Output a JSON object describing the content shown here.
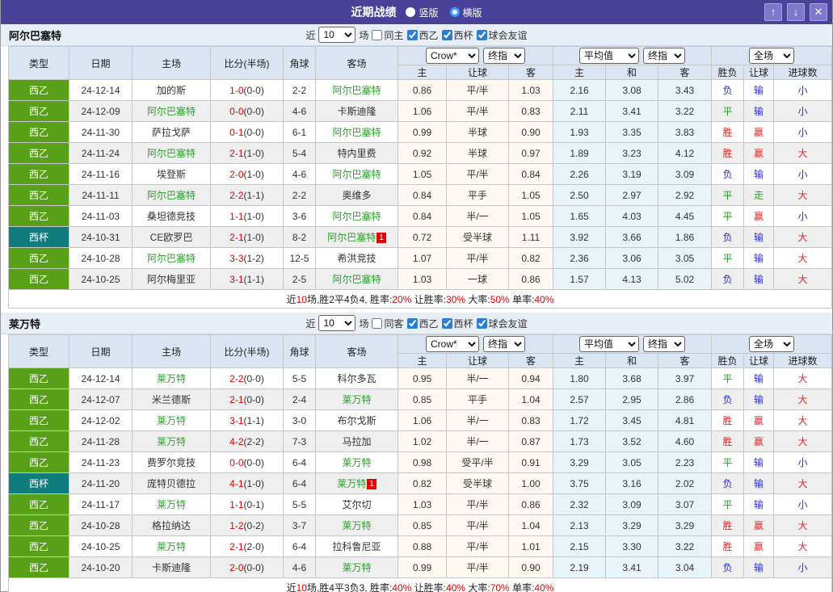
{
  "colors": {
    "titlebar": "#4a4198",
    "titlebar_button": "#7f77cb",
    "titlebar_button_border": "#aaa3e0",
    "filter_bg": "#e8eef5",
    "thead_bg": "#dbe5f1",
    "row_alt": "#efefef",
    "border": "#c6c6c6",
    "league_green": "#58a018",
    "cup_teal": "#0e7d7c",
    "team_green": "#2d9f2d",
    "score_red": "#e60000",
    "odds_bg": "#fdf8f1",
    "avg_bg": "#e9f4f8",
    "res_red": "#e02b2b",
    "res_blue": "#2c2cd8",
    "res_green": "#2d9f2d",
    "summary_red": "#e60000"
  },
  "titlebar": {
    "title": "近期战绩",
    "radios": [
      {
        "label": "竖版",
        "selected": false
      },
      {
        "label": "横版",
        "selected": true
      }
    ],
    "buttons": {
      "up": "↑",
      "down": "↓",
      "close": "✕"
    }
  },
  "filter_labels": {
    "near": "近",
    "games": "场"
  },
  "columns": {
    "static": [
      "类型",
      "日期",
      "主场",
      "比分(半场)",
      "角球",
      "客场"
    ],
    "sub": [
      "主",
      "让球",
      "客",
      "主",
      "和",
      "客",
      "胜负",
      "让球",
      "进球数"
    ]
  },
  "table_controls": {
    "book": "Crow*",
    "final1": "终指",
    "avg": "平均值",
    "final2": "终指",
    "full": "全场"
  },
  "sections": [
    {
      "team": "阿尔巴塞特",
      "filter": {
        "count": "10",
        "same": {
          "label": "同主",
          "checked": false
        },
        "cups": [
          {
            "label": "西乙",
            "checked": true
          },
          {
            "label": "西杯",
            "checked": true
          },
          {
            "label": "球会友谊",
            "checked": true
          }
        ]
      },
      "rows": [
        {
          "c": "league",
          "type": "西乙",
          "date": "24-12-14",
          "home": "加的斯",
          "hh": false,
          "score": "1-0",
          "half": "(0-0)",
          "corner": "2-2",
          "away": "阿尔巴塞特",
          "ah": true,
          "badge": "",
          "odds": [
            "0.86",
            "平/半",
            "1.03"
          ],
          "avg": [
            "2.16",
            "3.08",
            "3.43"
          ],
          "res": [
            [
              "负",
              "b"
            ],
            [
              "输",
              "b"
            ],
            [
              "小",
              "b"
            ]
          ]
        },
        {
          "c": "league",
          "type": "西乙",
          "date": "24-12-09",
          "home": "阿尔巴塞特",
          "hh": true,
          "score": "0-0",
          "half": "(0-0)",
          "corner": "4-6",
          "away": "卡斯迪隆",
          "ah": false,
          "badge": "",
          "odds": [
            "1.06",
            "平/半",
            "0.83"
          ],
          "avg": [
            "2.11",
            "3.41",
            "3.22"
          ],
          "res": [
            [
              "平",
              "g"
            ],
            [
              "输",
              "b"
            ],
            [
              "小",
              "b"
            ]
          ]
        },
        {
          "c": "league",
          "type": "西乙",
          "date": "24-11-30",
          "home": "萨拉戈萨",
          "hh": false,
          "score": "0-1",
          "half": "(0-0)",
          "corner": "6-1",
          "away": "阿尔巴塞特",
          "ah": true,
          "badge": "",
          "odds": [
            "0.99",
            "半球",
            "0.90"
          ],
          "avg": [
            "1.93",
            "3.35",
            "3.83"
          ],
          "res": [
            [
              "胜",
              "r"
            ],
            [
              "赢",
              "r"
            ],
            [
              "小",
              "b"
            ]
          ]
        },
        {
          "c": "league",
          "type": "西乙",
          "date": "24-11-24",
          "home": "阿尔巴塞特",
          "hh": true,
          "score": "2-1",
          "half": "(1-0)",
          "corner": "5-4",
          "away": "特内里费",
          "ah": false,
          "badge": "",
          "odds": [
            "0.92",
            "半球",
            "0.97"
          ],
          "avg": [
            "1.89",
            "3.23",
            "4.12"
          ],
          "res": [
            [
              "胜",
              "r"
            ],
            [
              "赢",
              "r"
            ],
            [
              "大",
              "r"
            ]
          ]
        },
        {
          "c": "league",
          "type": "西乙",
          "date": "24-11-16",
          "home": "埃登斯",
          "hh": false,
          "score": "2-0",
          "half": "(1-0)",
          "corner": "4-6",
          "away": "阿尔巴塞特",
          "ah": true,
          "badge": "",
          "odds": [
            "1.05",
            "平/半",
            "0.84"
          ],
          "avg": [
            "2.26",
            "3.19",
            "3.09"
          ],
          "res": [
            [
              "负",
              "b"
            ],
            [
              "输",
              "b"
            ],
            [
              "小",
              "b"
            ]
          ]
        },
        {
          "c": "league",
          "type": "西乙",
          "date": "24-11-11",
          "home": "阿尔巴塞特",
          "hh": true,
          "score": "2-2",
          "half": "(1-1)",
          "corner": "2-2",
          "away": "奥维多",
          "ah": false,
          "badge": "",
          "odds": [
            "0.84",
            "平手",
            "1.05"
          ],
          "avg": [
            "2.50",
            "2.97",
            "2.92"
          ],
          "res": [
            [
              "平",
              "g"
            ],
            [
              "走",
              "g"
            ],
            [
              "大",
              "r"
            ]
          ]
        },
        {
          "c": "league",
          "type": "西乙",
          "date": "24-11-03",
          "home": "桑坦德竞技",
          "hh": false,
          "score": "1-1",
          "half": "(1-0)",
          "corner": "3-6",
          "away": "阿尔巴塞特",
          "ah": true,
          "badge": "",
          "odds": [
            "0.84",
            "半/一",
            "1.05"
          ],
          "avg": [
            "1.65",
            "4.03",
            "4.45"
          ],
          "res": [
            [
              "平",
              "g"
            ],
            [
              "赢",
              "r"
            ],
            [
              "小",
              "b"
            ]
          ]
        },
        {
          "c": "cup",
          "type": "西杯",
          "date": "24-10-31",
          "home": "CE欧罗巴",
          "hh": false,
          "score": "2-1",
          "half": "(1-0)",
          "corner": "8-2",
          "away": "阿尔巴塞特",
          "ah": true,
          "badge": "1",
          "odds": [
            "0.72",
            "受半球",
            "1.11"
          ],
          "avg": [
            "3.92",
            "3.66",
            "1.86"
          ],
          "res": [
            [
              "负",
              "b"
            ],
            [
              "输",
              "b"
            ],
            [
              "大",
              "r"
            ]
          ]
        },
        {
          "c": "league",
          "type": "西乙",
          "date": "24-10-28",
          "home": "阿尔巴塞特",
          "hh": true,
          "score": "3-3",
          "half": "(1-2)",
          "corner": "12-5",
          "away": "希洪竞技",
          "ah": false,
          "badge": "",
          "odds": [
            "1.07",
            "平/半",
            "0.82"
          ],
          "avg": [
            "2.36",
            "3.06",
            "3.05"
          ],
          "res": [
            [
              "平",
              "g"
            ],
            [
              "输",
              "b"
            ],
            [
              "大",
              "r"
            ]
          ]
        },
        {
          "c": "league",
          "type": "西乙",
          "date": "24-10-25",
          "home": "阿尔梅里亚",
          "hh": false,
          "score": "3-1",
          "half": "(1-1)",
          "corner": "2-5",
          "away": "阿尔巴塞特",
          "ah": true,
          "badge": "",
          "odds": [
            "1.03",
            "一球",
            "0.86"
          ],
          "avg": [
            "1.57",
            "4.13",
            "5.02"
          ],
          "res": [
            [
              "负",
              "b"
            ],
            [
              "输",
              "b"
            ],
            [
              "大",
              "r"
            ]
          ]
        }
      ],
      "summary": [
        {
          "t": "近",
          "red": false
        },
        {
          "t": "10",
          "red": true
        },
        {
          "t": "场,胜2平4负4, 胜率:",
          "red": false
        },
        {
          "t": "20%",
          "red": true
        },
        {
          "t": " 让胜率:",
          "red": false
        },
        {
          "t": "30%",
          "red": true
        },
        {
          "t": " 大率:",
          "red": false
        },
        {
          "t": "50%",
          "red": true
        },
        {
          "t": " 单率:",
          "red": false
        },
        {
          "t": "40%",
          "red": true
        }
      ]
    },
    {
      "team": "莱万特",
      "filter": {
        "count": "10",
        "same": {
          "label": "同客",
          "checked": false
        },
        "cups": [
          {
            "label": "西乙",
            "checked": true
          },
          {
            "label": "西杯",
            "checked": true
          },
          {
            "label": "球会友谊",
            "checked": true
          }
        ]
      },
      "rows": [
        {
          "c": "league",
          "type": "西乙",
          "date": "24-12-14",
          "home": "莱万特",
          "hh": true,
          "score": "2-2",
          "half": "(0-0)",
          "corner": "5-5",
          "away": "科尔多瓦",
          "ah": false,
          "badge": "",
          "odds": [
            "0.95",
            "半/一",
            "0.94"
          ],
          "avg": [
            "1.80",
            "3.68",
            "3.97"
          ],
          "res": [
            [
              "平",
              "g"
            ],
            [
              "输",
              "b"
            ],
            [
              "大",
              "r"
            ]
          ]
        },
        {
          "c": "league",
          "type": "西乙",
          "date": "24-12-07",
          "home": "米兰德斯",
          "hh": false,
          "score": "2-1",
          "half": "(0-0)",
          "corner": "2-4",
          "away": "莱万特",
          "ah": true,
          "badge": "",
          "odds": [
            "0.85",
            "平手",
            "1.04"
          ],
          "avg": [
            "2.57",
            "2.95",
            "2.86"
          ],
          "res": [
            [
              "负",
              "b"
            ],
            [
              "输",
              "b"
            ],
            [
              "大",
              "r"
            ]
          ]
        },
        {
          "c": "league",
          "type": "西乙",
          "date": "24-12-02",
          "home": "莱万特",
          "hh": true,
          "score": "3-1",
          "half": "(1-1)",
          "corner": "3-0",
          "away": "布尔戈斯",
          "ah": false,
          "badge": "",
          "odds": [
            "1.06",
            "半/一",
            "0.83"
          ],
          "avg": [
            "1.72",
            "3.45",
            "4.81"
          ],
          "res": [
            [
              "胜",
              "r"
            ],
            [
              "赢",
              "r"
            ],
            [
              "大",
              "r"
            ]
          ]
        },
        {
          "c": "league",
          "type": "西乙",
          "date": "24-11-28",
          "home": "莱万特",
          "hh": true,
          "score": "4-2",
          "half": "(2-2)",
          "corner": "7-3",
          "away": "马拉加",
          "ah": false,
          "badge": "",
          "odds": [
            "1.02",
            "半/一",
            "0.87"
          ],
          "avg": [
            "1.73",
            "3.52",
            "4.60"
          ],
          "res": [
            [
              "胜",
              "r"
            ],
            [
              "赢",
              "r"
            ],
            [
              "大",
              "r"
            ]
          ]
        },
        {
          "c": "league",
          "type": "西乙",
          "date": "24-11-23",
          "home": "费罗尔竞技",
          "hh": false,
          "score": "0-0",
          "half": "(0-0)",
          "corner": "6-4",
          "away": "莱万特",
          "ah": true,
          "badge": "",
          "odds": [
            "0.98",
            "受平/半",
            "0.91"
          ],
          "avg": [
            "3.29",
            "3.05",
            "2.23"
          ],
          "res": [
            [
              "平",
              "g"
            ],
            [
              "输",
              "b"
            ],
            [
              "小",
              "b"
            ]
          ]
        },
        {
          "c": "cup",
          "type": "西杯",
          "date": "24-11-20",
          "home": "庞特贝德拉",
          "hh": false,
          "score": "4-1",
          "half": "(1-0)",
          "corner": "6-4",
          "away": "莱万特",
          "ah": true,
          "badge": "1",
          "odds": [
            "0.82",
            "受半球",
            "1.00"
          ],
          "avg": [
            "3.75",
            "3.16",
            "2.02"
          ],
          "res": [
            [
              "负",
              "b"
            ],
            [
              "输",
              "b"
            ],
            [
              "大",
              "r"
            ]
          ]
        },
        {
          "c": "league",
          "type": "西乙",
          "date": "24-11-17",
          "home": "莱万特",
          "hh": true,
          "score": "1-1",
          "half": "(0-1)",
          "corner": "5-5",
          "away": "艾尔切",
          "ah": false,
          "badge": "",
          "odds": [
            "1.03",
            "平/半",
            "0.86"
          ],
          "avg": [
            "2.32",
            "3.09",
            "3.07"
          ],
          "res": [
            [
              "平",
              "g"
            ],
            [
              "输",
              "b"
            ],
            [
              "小",
              "b"
            ]
          ]
        },
        {
          "c": "league",
          "type": "西乙",
          "date": "24-10-28",
          "home": "格拉纳达",
          "hh": false,
          "score": "1-2",
          "half": "(0-2)",
          "corner": "3-7",
          "away": "莱万特",
          "ah": true,
          "badge": "",
          "odds": [
            "0.85",
            "平/半",
            "1.04"
          ],
          "avg": [
            "2.13",
            "3.29",
            "3.29"
          ],
          "res": [
            [
              "胜",
              "r"
            ],
            [
              "赢",
              "r"
            ],
            [
              "大",
              "r"
            ]
          ]
        },
        {
          "c": "league",
          "type": "西乙",
          "date": "24-10-25",
          "home": "莱万特",
          "hh": true,
          "score": "2-1",
          "half": "(2-0)",
          "corner": "6-4",
          "away": "拉科鲁尼亚",
          "ah": false,
          "badge": "",
          "odds": [
            "0.88",
            "平/半",
            "1.01"
          ],
          "avg": [
            "2.15",
            "3.30",
            "3.22"
          ],
          "res": [
            [
              "胜",
              "r"
            ],
            [
              "赢",
              "r"
            ],
            [
              "大",
              "r"
            ]
          ]
        },
        {
          "c": "league",
          "type": "西乙",
          "date": "24-10-20",
          "home": "卡斯迪隆",
          "hh": false,
          "score": "2-0",
          "half": "(0-0)",
          "corner": "4-6",
          "away": "莱万特",
          "ah": true,
          "badge": "",
          "odds": [
            "0.99",
            "平/半",
            "0.90"
          ],
          "avg": [
            "2.19",
            "3.41",
            "3.04"
          ],
          "res": [
            [
              "负",
              "b"
            ],
            [
              "输",
              "b"
            ],
            [
              "小",
              "b"
            ]
          ]
        }
      ],
      "summary": [
        {
          "t": "近",
          "red": false
        },
        {
          "t": "10",
          "red": true
        },
        {
          "t": "场,胜4平3负3, 胜率:",
          "red": false
        },
        {
          "t": "40%",
          "red": true
        },
        {
          "t": " 让胜率:",
          "red": false
        },
        {
          "t": "40%",
          "red": true
        },
        {
          "t": " 大率:",
          "red": false
        },
        {
          "t": "70%",
          "red": true
        },
        {
          "t": " 单率:",
          "red": false
        },
        {
          "t": "40%",
          "red": true
        }
      ]
    }
  ]
}
